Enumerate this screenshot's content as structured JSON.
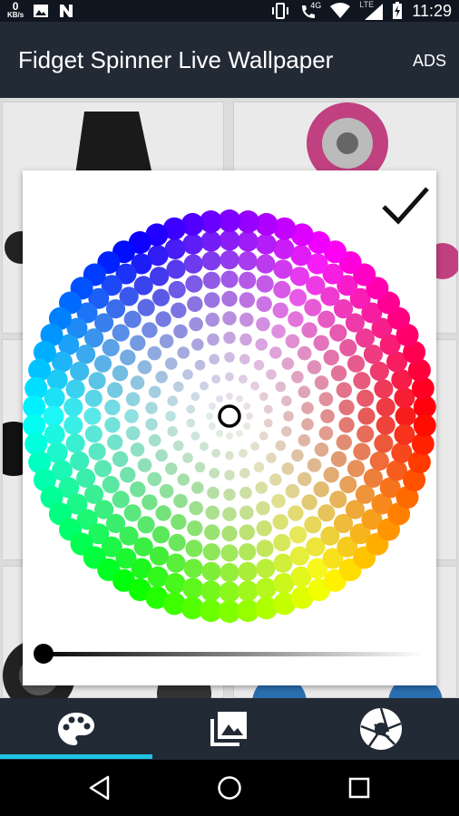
{
  "status_bar": {
    "net_speed": "0",
    "net_unit": "KB/s",
    "network_label": "4G",
    "lte_label": "LTE",
    "time": "11:29",
    "icons": [
      "image-icon",
      "n-icon",
      "vibrate-icon",
      "wifi-call-icon",
      "wifi-icon",
      "signal-icon",
      "battery-charging-icon"
    ]
  },
  "app_bar": {
    "title": "Fidget Spinner Live Wallpaper",
    "ads_label": "ADS"
  },
  "color_picker": {
    "confirm_icon": "checkmark-icon",
    "brightness_level": 0.0
  },
  "bottom_nav": {
    "items": [
      {
        "icon": "palette-icon",
        "selected": true
      },
      {
        "icon": "gallery-icon",
        "selected": false
      },
      {
        "icon": "shutter-icon",
        "selected": false
      }
    ],
    "indicator_color": "#1ec3e4"
  },
  "system_nav": {
    "items": [
      "back-icon",
      "home-icon",
      "recents-icon"
    ]
  }
}
